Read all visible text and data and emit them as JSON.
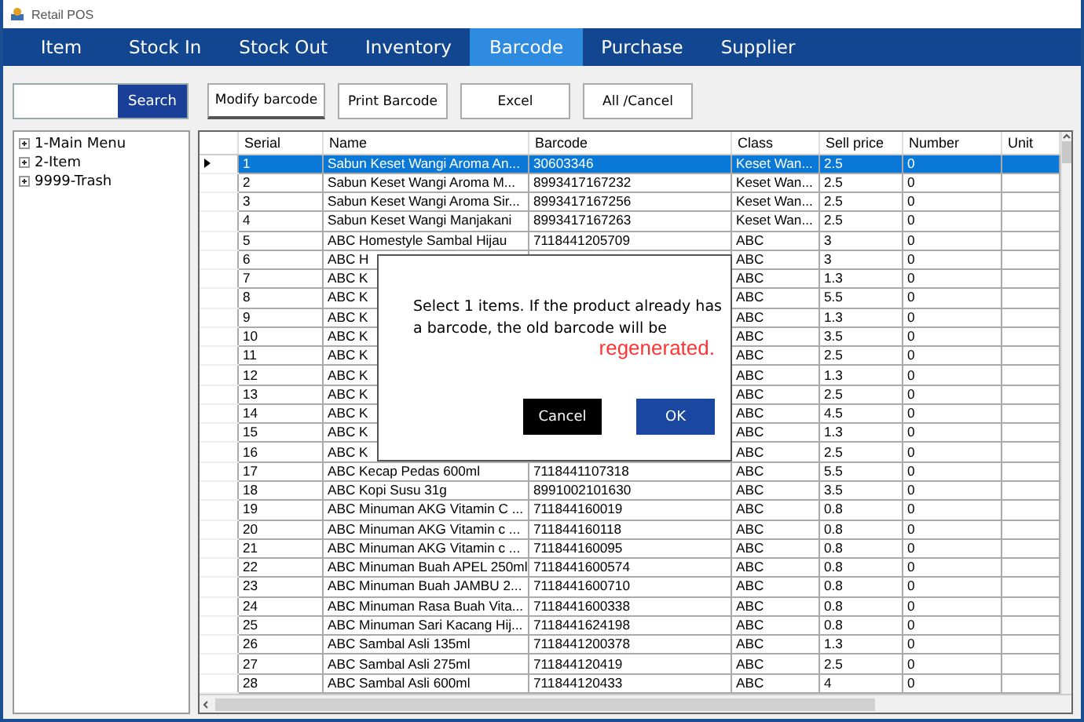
{
  "window": {
    "title": "Retail POS"
  },
  "tabs": [
    {
      "label": "Item",
      "selected": false
    },
    {
      "label": "Stock In",
      "selected": false
    },
    {
      "label": "Stock Out",
      "selected": false
    },
    {
      "label": "Inventory",
      "selected": false
    },
    {
      "label": "Barcode",
      "selected": true
    },
    {
      "label": "Purchase",
      "selected": false
    },
    {
      "label": "Supplier",
      "selected": false
    }
  ],
  "search": {
    "button": "Search"
  },
  "toolbar": [
    "Modify barcode",
    "Print Barcode",
    "Excel",
    "All /Cancel"
  ],
  "tree": [
    {
      "label": "1-Main Menu",
      "expanded": false
    },
    {
      "label": "2-Item",
      "expanded": false
    },
    {
      "label": "9999-Trash",
      "expanded": false
    }
  ],
  "table": {
    "columns": [
      "Serial",
      "Name",
      "Barcode",
      "Class",
      "Sell price",
      "Number",
      "Unit"
    ],
    "rows": [
      {
        "serial": "1",
        "name": "Sabun Keset Wangi Aroma An...",
        "barcode": "30603346",
        "class": "Keset Wan...",
        "price": "2.5",
        "number": "0",
        "selected": true
      },
      {
        "serial": "2",
        "name": "Sabun Keset Wangi Aroma M...",
        "barcode": "8993417167232",
        "class": "Keset Wan...",
        "price": "2.5",
        "number": "0",
        "selected": false
      },
      {
        "serial": "3",
        "name": "Sabun Keset Wangi Aroma Sir...",
        "barcode": "8993417167256",
        "class": "Keset Wan...",
        "price": "2.5",
        "number": "0",
        "selected": false
      },
      {
        "serial": "4",
        "name": "Sabun Keset Wangi Manjakani",
        "barcode": "8993417167263",
        "class": "Keset Wan...",
        "price": "2.5",
        "number": "0",
        "selected": false
      },
      {
        "serial": "5",
        "name": "ABC Homestyle Sambal Hijau",
        "barcode": "7118441205709",
        "class": "ABC",
        "price": "3",
        "number": "0",
        "selected": false
      },
      {
        "serial": "6",
        "name": "ABC H",
        "class": "ABC",
        "price": "3",
        "number": "0",
        "selected": false
      },
      {
        "serial": "7",
        "name": "ABC K",
        "class": "ABC",
        "price": "1.3",
        "number": "0",
        "selected": false
      },
      {
        "serial": "8",
        "name": "ABC K",
        "class": "ABC",
        "price": "5.5",
        "number": "0",
        "selected": false
      },
      {
        "serial": "9",
        "name": "ABC K",
        "class": "ABC",
        "price": "1.3",
        "number": "0",
        "selected": false
      },
      {
        "serial": "10",
        "name": "ABC K",
        "class": "ABC",
        "price": "3.5",
        "number": "0",
        "selected": false
      },
      {
        "serial": "11",
        "name": "ABC K",
        "class": "ABC",
        "price": "2.5",
        "number": "0",
        "selected": false
      },
      {
        "serial": "12",
        "name": "ABC K",
        "class": "ABC",
        "price": "1.3",
        "number": "0",
        "selected": false
      },
      {
        "serial": "13",
        "name": "ABC K",
        "class": "ABC",
        "price": "2.5",
        "number": "0",
        "selected": false
      },
      {
        "serial": "14",
        "name": "ABC K",
        "class": "ABC",
        "price": "4.5",
        "number": "0",
        "selected": false
      },
      {
        "serial": "15",
        "name": "ABC K",
        "class": "ABC",
        "price": "1.3",
        "number": "0",
        "selected": false
      },
      {
        "serial": "16",
        "name": "ABC K",
        "class": "ABC",
        "price": "2.5",
        "number": "0",
        "selected": false
      },
      {
        "serial": "17",
        "name": "ABC Kecap Pedas 600ml",
        "barcode": "7118441107318",
        "class": "ABC",
        "price": "5.5",
        "number": "0",
        "selected": false
      },
      {
        "serial": "18",
        "name": "ABC Kopi Susu 31g",
        "barcode": "8991002101630",
        "class": "ABC",
        "price": "3.5",
        "number": "0",
        "selected": false
      },
      {
        "serial": "19",
        "name": "ABC Minuman AKG Vitamin C ...",
        "barcode": "711844160019",
        "class": "ABC",
        "price": "0.8",
        "number": "0",
        "selected": false
      },
      {
        "serial": "20",
        "name": "ABC Minuman AKG Vitamin c ...",
        "barcode": "711844160118",
        "class": "ABC",
        "price": "0.8",
        "number": "0",
        "selected": false
      },
      {
        "serial": "21",
        "name": "ABC Minuman AKG Vitamin c ...",
        "barcode": "711844160095",
        "class": "ABC",
        "price": "0.8",
        "number": "0",
        "selected": false
      },
      {
        "serial": "22",
        "name": "ABC Minuman Buah APEL 250ml",
        "barcode": "7118441600574",
        "class": "ABC",
        "price": "0.8",
        "number": "0",
        "selected": false
      },
      {
        "serial": "23",
        "name": "ABC Minuman Buah JAMBU 2...",
        "barcode": "7118441600710",
        "class": "ABC",
        "price": "0.8",
        "number": "0",
        "selected": false
      },
      {
        "serial": "24",
        "name": "ABC Minuman Rasa Buah Vita...",
        "barcode": "7118441600338",
        "class": "ABC",
        "price": "0.8",
        "number": "0",
        "selected": false
      },
      {
        "serial": "25",
        "name": "ABC Minuman Sari Kacang Hij...",
        "barcode": "7118441624198",
        "class": "ABC",
        "price": "0.8",
        "number": "0",
        "selected": false
      },
      {
        "serial": "26",
        "name": "ABC Sambal Asli 135ml",
        "barcode": "7118441200378",
        "class": "ABC",
        "price": "1.3",
        "number": "0",
        "selected": false
      },
      {
        "serial": "27",
        "name": "ABC Sambal Asli 275ml",
        "barcode": "711844120419",
        "class": "ABC",
        "price": "2.5",
        "number": "0",
        "selected": false
      },
      {
        "serial": "28",
        "name": "ABC Sambal Asli 600ml",
        "barcode": "711844120433",
        "class": "ABC",
        "price": "4",
        "number": "0",
        "selected": false
      }
    ]
  },
  "dialog": {
    "message": "Select 1 items. If the product already has a barcode, the old barcode will be",
    "highlight": "regenerated.",
    "buttons": [
      {
        "label": "Cancel",
        "kind": "secondary"
      },
      {
        "label": "OK",
        "kind": "primary"
      }
    ]
  }
}
